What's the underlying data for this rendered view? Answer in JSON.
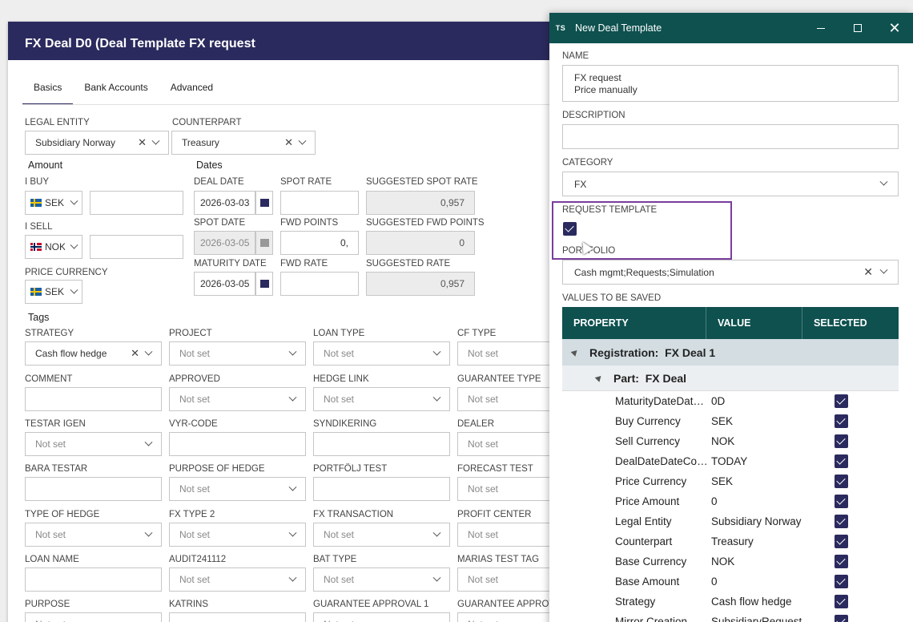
{
  "deal_window": {
    "title": "FX Deal D0 (Deal Template FX request",
    "tabs": [
      "Basics",
      "Bank Accounts",
      "Advanced"
    ],
    "legal_entity": {
      "label": "LEGAL ENTITY",
      "value": "Subsidiary Norway"
    },
    "counterpart": {
      "label": "COUNTERPART",
      "value": "Treasury"
    },
    "amount_section": "Amount",
    "dates_section": "Dates",
    "i_buy": {
      "label": "I BUY",
      "currency": "SEK"
    },
    "i_sell": {
      "label": "I SELL",
      "currency": "NOK"
    },
    "price_currency": {
      "label": "PRICE CURRENCY",
      "currency": "SEK"
    },
    "deal_date": {
      "label": "DEAL DATE",
      "value": "2026-03-03"
    },
    "spot_date": {
      "label": "SPOT DATE",
      "value": "2026-03-05"
    },
    "maturity_date": {
      "label": "MATURITY DATE",
      "value": "2026-03-05"
    },
    "spot_rate": {
      "label": "SPOT RATE",
      "value": ""
    },
    "fwd_points": {
      "label": "FWD POINTS",
      "value": "0,"
    },
    "fwd_rate": {
      "label": "FWD RATE",
      "value": ""
    },
    "suggested_spot_rate": {
      "label": "SUGGESTED SPOT RATE",
      "value": "0,957"
    },
    "suggested_fwd_points": {
      "label": "SUGGESTED FWD POINTS",
      "value": "0"
    },
    "suggested_rate": {
      "label": "SUGGESTED RATE",
      "value": "0,957"
    },
    "tags_section": "Tags",
    "not_set": "Not set",
    "tags": {
      "strategy": {
        "label": "STRATEGY",
        "value": "Cash flow hedge"
      },
      "project": "PROJECT",
      "loan_type": "LOAN TYPE",
      "cf_type": "CF TYPE",
      "comment": "COMMENT",
      "approved": "APPROVED",
      "hedge_link": "HEDGE LINK",
      "guarantee_type": "GUARANTEE TYPE",
      "testar_igen": "TESTAR IGEN",
      "vyr_code": "VYR-CODE",
      "syndikering": "SYNDIKERING",
      "dealer": "DEALER",
      "bara_testar": "BARA TESTAR",
      "purpose_of_hedge": "PURPOSE OF HEDGE",
      "portfolj_test": "PORTFÖLJ TEST",
      "forecast_test": "FORECAST TEST",
      "type_of_hedge": "TYPE OF HEDGE",
      "fx_type_2": "FX TYPE 2",
      "fx_transaction": "FX TRANSACTION",
      "profit_center": "PROFIT CENTER",
      "loan_name": "LOAN NAME",
      "audit": "AUDIT241112",
      "bat_type": "BAT TYPE",
      "marias_test_tag": "MARIAS TEST TAG",
      "purpose": "PURPOSE",
      "katrins": "KATRINS",
      "guarantee_approval_1": "GUARANTEE APPROVAL 1",
      "guarantee_approv": "GUARANTEE APPROV"
    }
  },
  "dialog": {
    "logo": "TS",
    "title": "New Deal Template",
    "name_label": "NAME",
    "name_lines": [
      "FX request",
      "Price manually"
    ],
    "description_label": "DESCRIPTION",
    "description_value": "",
    "category_label": "CATEGORY",
    "category_value": "FX",
    "request_template_label": "REQUEST TEMPLATE",
    "request_template_checked": true,
    "portfolio_label": "PORTFOLIO",
    "portfolio_value": "Cash mgmt;Requests;Simulation",
    "values_label": "VALUES TO BE SAVED",
    "columns": [
      "PROPERTY",
      "VALUE",
      "SELECTED"
    ],
    "group_registration": {
      "key": "Registration:",
      "value": "FX Deal 1"
    },
    "group_part": {
      "key": "Part:",
      "value": "FX Deal"
    },
    "rows": [
      {
        "property": "MaturityDateDateCode",
        "value": "0D"
      },
      {
        "property": "Buy Currency",
        "value": "SEK"
      },
      {
        "property": "Sell Currency",
        "value": "NOK"
      },
      {
        "property": "DealDateDateCode",
        "value": "TODAY"
      },
      {
        "property": "Price Currency",
        "value": "SEK"
      },
      {
        "property": "Price Amount",
        "value": "0"
      },
      {
        "property": "Legal Entity",
        "value": "Subsidiary Norway"
      },
      {
        "property": "Counterpart",
        "value": "Treasury"
      },
      {
        "property": "Base Currency",
        "value": "NOK"
      },
      {
        "property": "Base Amount",
        "value": "0"
      },
      {
        "property": "Strategy",
        "value": "Cash flow hedge"
      },
      {
        "property": "Mirror Creation",
        "value": "SubsidiaryRequest"
      }
    ]
  }
}
